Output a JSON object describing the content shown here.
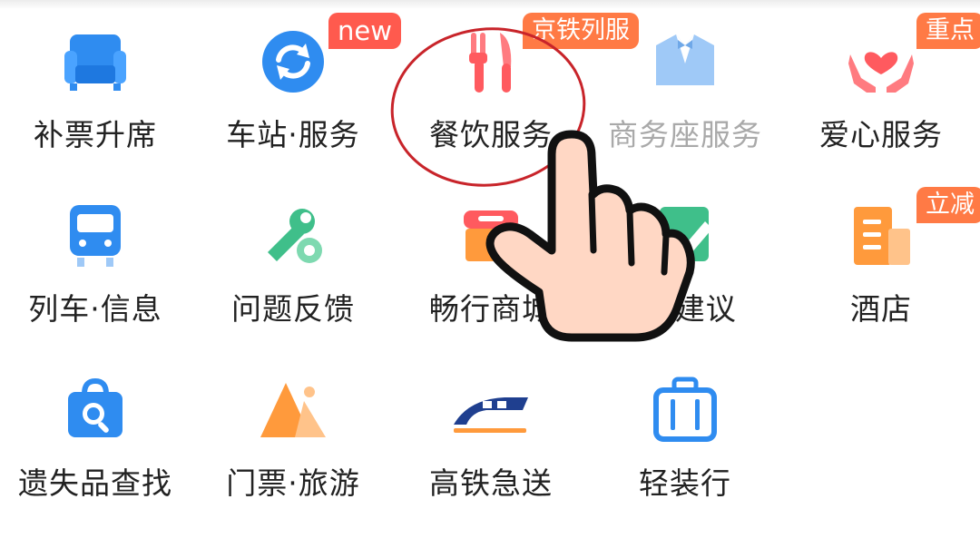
{
  "grid": {
    "rows": [
      [
        {
          "label": "补票升席",
          "icon": "sofa-icon"
        },
        {
          "label": "车站·服务",
          "icon": "refresh-icon",
          "badge": "new"
        },
        {
          "label": "餐饮服务",
          "icon": "fork-knife-icon",
          "badge": "京铁列服"
        },
        {
          "label": "商务座服务",
          "icon": "tuxedo-icon"
        },
        {
          "label": "爱心服务",
          "icon": "heart-hands-icon",
          "badge": "重点"
        }
      ],
      [
        {
          "label": "列车·信息",
          "icon": "train-icon"
        },
        {
          "label": "问题反馈",
          "icon": "wrench-gear-icon"
        },
        {
          "label": "畅行商城",
          "icon": "shop-icon"
        },
        {
          "label": "卷·建议",
          "icon": "pencil-note-icon"
        },
        {
          "label": "酒店",
          "icon": "hotel-icon",
          "badge": "立减"
        }
      ],
      [
        {
          "label": "遗失品查找",
          "icon": "lost-bag-search-icon"
        },
        {
          "label": "门票·旅游",
          "icon": "mountain-icon"
        },
        {
          "label": "高铁急送",
          "icon": "express-train-icon"
        },
        {
          "label": "轻装行",
          "icon": "luggage-icon"
        }
      ]
    ]
  },
  "colors": {
    "badge_orange": "#ff7a45",
    "badge_red": "#ff5a4e",
    "icon_blue": "#2f8cf0",
    "icon_red": "#ff5a5f",
    "icon_green": "#3fbf8a",
    "icon_orange": "#ff9a3c",
    "circle_annotation": "#c8242a",
    "hand_fill": "#ffd7c4"
  }
}
